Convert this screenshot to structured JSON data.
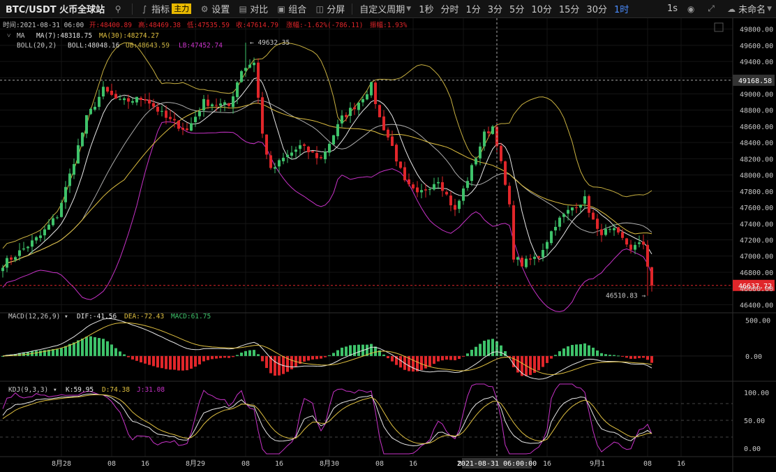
{
  "toolbar": {
    "symbol": "BTC/USDT 火币全球站",
    "indicators_label": "指标",
    "indicators_badge": "主力",
    "settings_label": "设置",
    "compare_label": "对比",
    "combo_label": "组合",
    "split_label": "分屏",
    "custom_period_label": "自定义周期",
    "timeframes": [
      "1秒",
      "分时",
      "1分",
      "3分",
      "5分",
      "10分",
      "15分",
      "30分",
      "1时"
    ],
    "active_timeframe": "1时",
    "right_tf": "1s",
    "user_label": "未命名"
  },
  "info": {
    "time": "时间:2021-08-31 06:00",
    "open": "开:48400.89",
    "high": "高:48469.38",
    "low": "低:47535.59",
    "close": "收:47614.79",
    "change": "涨幅:-1.62%(-786.11)",
    "amp": "振幅:1.93%"
  },
  "ma": {
    "name": "MA",
    "ma7": "MA(7):48318.75",
    "ma30": "MA(30):48274.27"
  },
  "boll": {
    "name": "BOLL(20,2)",
    "mid": "BOLL:48048.16",
    "ub": "UB:48643.59",
    "lb": "LB:47452.74"
  },
  "macd": {
    "name": "MACD(12,26,9)",
    "dif": "DIF:-41.56",
    "dea": "DEA:-72.43",
    "macd": "MACD:61.75"
  },
  "kdj": {
    "name": "KDJ(9,3,3)",
    "k": "K:59.95",
    "d": "D:74.38",
    "j": "J:31.08"
  },
  "annotations": {
    "max_label": "← 49632.35",
    "min_label": "46510.83 →"
  },
  "price_tags": {
    "last": "46637.72",
    "cross": "49168.58"
  },
  "crosshair_time": "2021-08-31 06:00:00",
  "colors": {
    "up": "#3ec26a",
    "down": "#e0262a",
    "ma7": "#e6e6e6",
    "ma30": "#e0c040",
    "boll_mid": "#d8d8d8",
    "boll_ub": "#c8b040",
    "boll_lb": "#c832c8"
  },
  "chart_data": {
    "type": "candlestick",
    "price_axis": {
      "ticks": [
        46400,
        46600,
        46800,
        47000,
        47200,
        47400,
        47600,
        47800,
        48000,
        48200,
        48400,
        48600,
        48800,
        49000,
        49200,
        49400,
        49600,
        49800
      ],
      "range": [
        46300,
        49900
      ]
    },
    "macd_axis": {
      "ticks": [
        500,
        0
      ],
      "tick_labels": [
        "500.00",
        "0.00"
      ],
      "range": [
        -350,
        600
      ]
    },
    "kdj_axis": {
      "ticks": [
        100,
        50,
        0
      ],
      "tick_labels": [
        "100.00",
        "50.00",
        "0.00"
      ],
      "range": [
        -15,
        120
      ]
    },
    "x_labels": [
      {
        "i": 14,
        "text": "8月28"
      },
      {
        "i": 26,
        "text": "08"
      },
      {
        "i": 34,
        "text": "16"
      },
      {
        "i": 46,
        "text": "8月29"
      },
      {
        "i": 58,
        "text": "08"
      },
      {
        "i": 66,
        "text": "16"
      },
      {
        "i": 78,
        "text": "8月30"
      },
      {
        "i": 90,
        "text": "08"
      },
      {
        "i": 98,
        "text": "16"
      },
      {
        "i": 110,
        "text": "8月"
      },
      {
        "i": 130,
        "text": "16"
      },
      {
        "i": 142,
        "text": "9月1"
      },
      {
        "i": 154,
        "text": "08"
      },
      {
        "i": 162,
        "text": "16"
      }
    ],
    "crosshair_index": 118,
    "key_points": [
      [
        0,
        46900
      ],
      [
        4,
        47050
      ],
      [
        9,
        47250
      ],
      [
        13,
        47500
      ],
      [
        16,
        48000
      ],
      [
        20,
        48700
      ],
      [
        24,
        49050
      ],
      [
        28,
        48900
      ],
      [
        34,
        48950
      ],
      [
        39,
        48700
      ],
      [
        44,
        48550
      ],
      [
        48,
        48900
      ],
      [
        54,
        48850
      ],
      [
        57,
        49300
      ],
      [
        60,
        49400
      ],
      [
        62,
        48500
      ],
      [
        64,
        48050
      ],
      [
        67,
        48200
      ],
      [
        71,
        48350
      ],
      [
        76,
        48200
      ],
      [
        81,
        48700
      ],
      [
        85,
        48900
      ],
      [
        88,
        49100
      ],
      [
        90,
        48700
      ],
      [
        93,
        48350
      ],
      [
        96,
        47900
      ],
      [
        99,
        47750
      ],
      [
        104,
        47950
      ],
      [
        108,
        47550
      ],
      [
        111,
        47950
      ],
      [
        115,
        48500
      ],
      [
        117,
        48600
      ],
      [
        118,
        48400
      ],
      [
        121,
        47600
      ],
      [
        122,
        47000
      ],
      [
        124,
        46900
      ],
      [
        128,
        47000
      ],
      [
        132,
        47400
      ],
      [
        136,
        47600
      ],
      [
        139,
        47700
      ],
      [
        142,
        47300
      ],
      [
        146,
        47300
      ],
      [
        150,
        47100
      ],
      [
        153,
        47150
      ],
      [
        155,
        46637
      ]
    ],
    "max_point": {
      "i": 58,
      "price": 49632.35
    },
    "min_point": {
      "i": 154,
      "price": 46510.83
    }
  }
}
